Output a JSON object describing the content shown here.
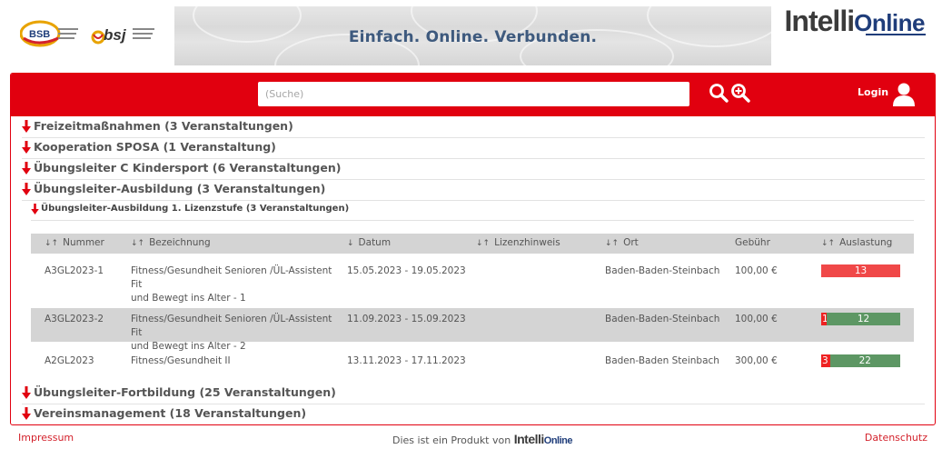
{
  "header": {
    "logo_bsb_text": "BSB",
    "logo_bsj_text": "bsj",
    "banner_text": "Einfach. Online. Verbunden.",
    "brand_part1": "Intelli",
    "brand_part2": "Online"
  },
  "toolbar": {
    "search_placeholder": "(Suche)",
    "login_label": "Login",
    "search_icon": "search-icon",
    "advanced_search_icon": "zoom-plus-icon",
    "user_icon": "user-icon"
  },
  "categories": [
    {
      "label": "Freizeitmaßnahmen (3 Veranstaltungen)"
    },
    {
      "label": "Kooperation SPOSA (1 Veranstaltung)"
    },
    {
      "label": "Übungsleiter C Kindersport (6 Veranstaltungen)"
    },
    {
      "label": "Übungsleiter-Ausbildung (3 Veranstaltungen)"
    }
  ],
  "subcategory": {
    "label": "Übungsleiter-Ausbildung 1. Lizenzstufe (3 Veranstaltungen)"
  },
  "table": {
    "headers": {
      "nummer": "Nummer",
      "bezeichnung": "Bezeichnung",
      "datum": "Datum",
      "lizenzhinweis": "Lizenzhinweis",
      "ort": "Ort",
      "gebuehr": "Gebühr",
      "auslastung": "Auslastung"
    },
    "rows": [
      {
        "nummer": "A3GL2023-1",
        "bezeichnung_l1": "Fitness/Gesundheit Senioren /ÜL-Assistent Fit",
        "bezeichnung_l2": "und Bewegt ins Alter - 1",
        "datum": "15.05.2023 - 19.05.2023",
        "lizenzhinweis": "",
        "ort": "Baden-Baden-Steinbach",
        "gebuehr": "100,00 €",
        "auslastung_free": "",
        "auslastung_booked": "13",
        "free_fraction": 0,
        "booked_fraction": 1
      },
      {
        "nummer": "A3GL2023-2",
        "bezeichnung_l1": "Fitness/Gesundheit Senioren /ÜL-Assistent Fit",
        "bezeichnung_l2": "und Bewegt ins Alter - 2",
        "datum": "11.09.2023 - 15.09.2023",
        "lizenzhinweis": "",
        "ort": "Baden-Baden-Steinbach",
        "gebuehr": "100,00 €",
        "auslastung_free": "1",
        "auslastung_booked": "12",
        "free_fraction": 0.07,
        "booked_fraction": 0.93
      },
      {
        "nummer": "A2GL2023",
        "bezeichnung_l1": "Fitness/Gesundheit II",
        "bezeichnung_l2": "",
        "datum": "13.11.2023 - 17.11.2023",
        "lizenzhinweis": "",
        "ort": "Baden-Baden Steinbach",
        "gebuehr": "300,00 €",
        "auslastung_free": "3",
        "auslastung_booked": "22",
        "free_fraction": 0.11,
        "booked_fraction": 0.89
      }
    ]
  },
  "categories_bottom": [
    {
      "label": "Übungsleiter-Fortbildung (25 Veranstaltungen)"
    },
    {
      "label": "Vereinsmanagement (18 Veranstaltungen)"
    }
  ],
  "footer": {
    "impressum": "Impressum",
    "product_text": "Dies ist ein Produkt von",
    "product_brand1": "Intelli",
    "product_brand2": "Online",
    "datenschutz": "Datenschutz"
  },
  "colors": {
    "accent": "#e1000f",
    "full": "#f04848",
    "free": "#ee2222",
    "booked": "#5d9764"
  }
}
